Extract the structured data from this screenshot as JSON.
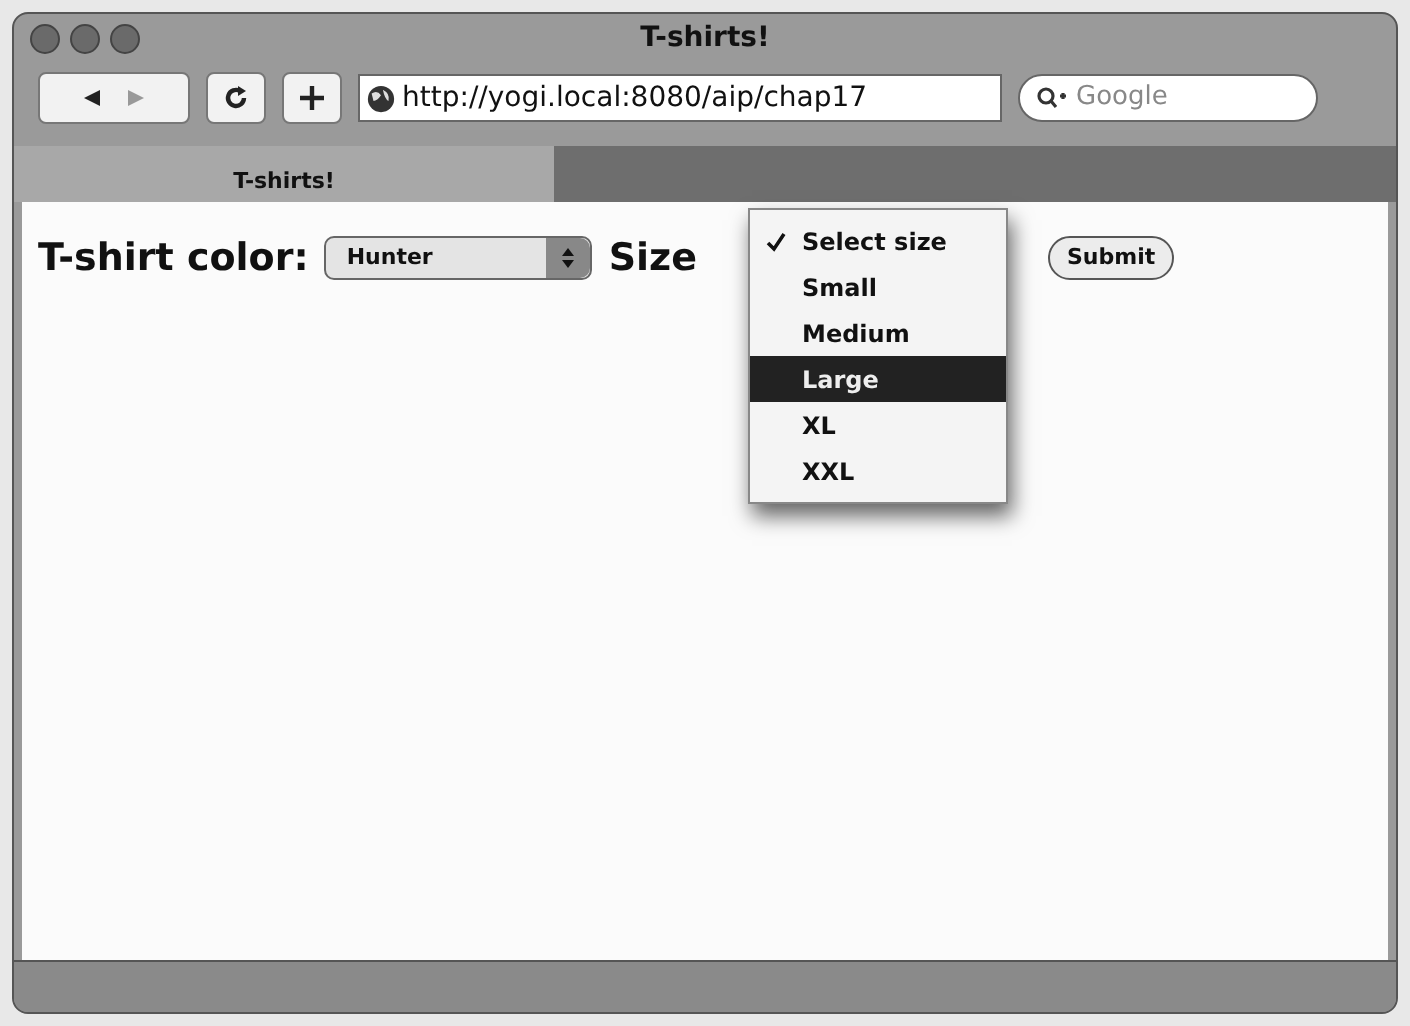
{
  "window": {
    "title": "T-shirts!"
  },
  "toolbar": {
    "address": "http://yogi.local:8080/aip/chap17",
    "search": {
      "placeholder": "Google"
    }
  },
  "tabs": [
    {
      "label": "T-shirts!",
      "selected": true
    }
  ],
  "form": {
    "color_label": "T-shirt color:",
    "color_value": "Hunter",
    "size_label": "Size",
    "submit": "Submit"
  },
  "size_menu": [
    {
      "label": "Select size",
      "selected": true,
      "highlighted": false
    },
    {
      "label": "Small",
      "selected": false,
      "highlighted": false
    },
    {
      "label": "Medium",
      "selected": false,
      "highlighted": false
    },
    {
      "label": "Large",
      "selected": false,
      "highlighted": true
    },
    {
      "label": "XL",
      "selected": false,
      "highlighted": false
    },
    {
      "label": "XXL",
      "selected": false,
      "highlighted": false
    }
  ]
}
